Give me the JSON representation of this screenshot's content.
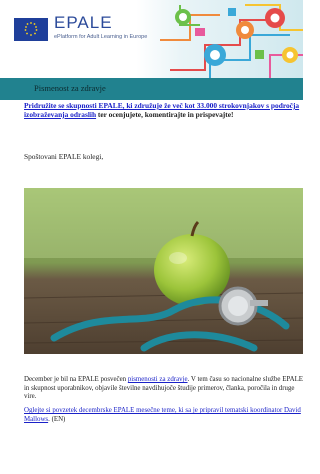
{
  "header": {
    "brand_name": "EPALE",
    "brand_tagline": "ePlatform for Adult Learning in Europe",
    "colors": {
      "brand": "#2b4a9a",
      "eu_blue": "#1f3f9a",
      "eu_star": "#ffd617"
    }
  },
  "nav": {
    "item_label": "Pismenost za zdravje",
    "color": "#21828f"
  },
  "intro": {
    "link_text": "Pridružite se skupnosti EPALE, ki združuje že več kot 33.000 strokovnjakov s področja izobraževanja odraslih",
    "rest_text": " ter ocenjujete, komentirajte in prispevajte!"
  },
  "greeting": "Spoštovani EPALE kolegi,",
  "image": {
    "subject": "apple-and-stethoscope-photo"
  },
  "paragraph1": {
    "before": "December je bil na EPALE posvečen ",
    "link_text": "pismenosti za zdravje",
    "after": ". V tem času so nacionalne službe EPALE in skupnost uporabnikov, objavile številne navdihujoče študije primerov, članka, poročila in druge vire."
  },
  "paragraph2": {
    "link_text": "Oglejte si povzetek decembrske EPALE mesečne teme, ki sa je pripravil tematski koordinator David Mallows",
    "after": ". (EN)"
  }
}
